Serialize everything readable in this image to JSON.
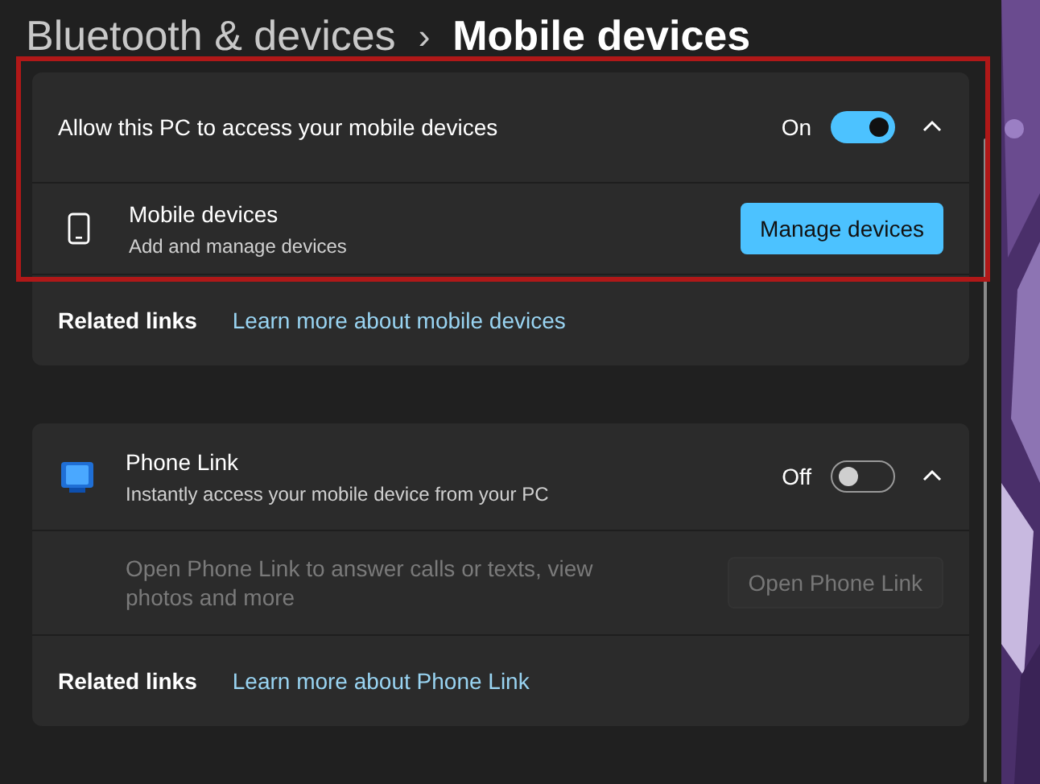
{
  "breadcrumb": {
    "parent": "Bluetooth & devices",
    "separator": "›",
    "current": "Mobile devices"
  },
  "sections": [
    {
      "kind": "plain",
      "title": "Allow this PC to access your mobile devices",
      "toggle": {
        "label": "On",
        "on": true
      },
      "expanded": true,
      "highlighted": true,
      "row": {
        "kind": "device",
        "title": "Mobile devices",
        "subtitle": "Add and manage devices",
        "button": {
          "label": "Manage devices",
          "disabled": false
        }
      },
      "related": {
        "label": "Related links",
        "link": "Learn more about mobile devices"
      }
    },
    {
      "kind": "app",
      "title": "Phone Link",
      "subtitle": "Instantly access your mobile device from your PC",
      "toggle": {
        "label": "Off",
        "on": false
      },
      "expanded": true,
      "highlighted": false,
      "row": {
        "kind": "text",
        "title": "Open Phone Link to answer calls or texts, view photos and more",
        "button": {
          "label": "Open Phone Link",
          "disabled": true
        }
      },
      "related": {
        "label": "Related links",
        "link": "Learn more about Phone Link"
      }
    }
  ]
}
